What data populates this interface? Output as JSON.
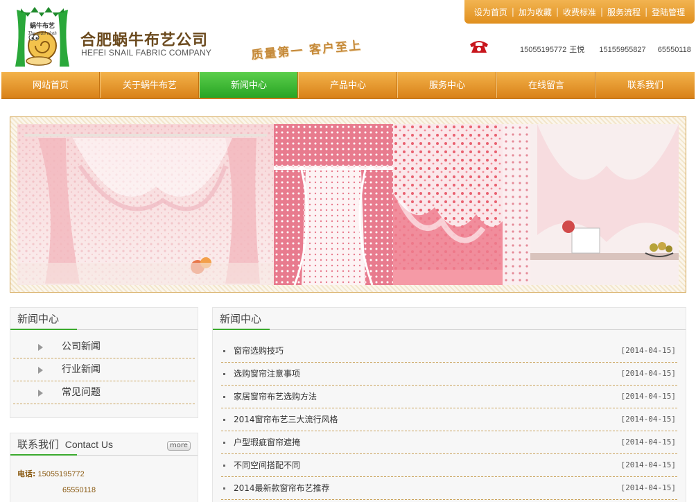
{
  "header": {
    "logo_text_cn": "蜗牛布艺",
    "logo_text_en": "The snail cloth",
    "company_name_cn": "合肥蜗牛布艺公司",
    "company_name_en": "HEFEI SNAIL FABRIC COMPANY",
    "slogan": "质量第一 客户至上",
    "top_links": [
      "设为首页",
      "加为收藏",
      "收费标准",
      "服务流程",
      "登陆管理"
    ],
    "phone_icon": "telephone-icon",
    "phones": [
      "15055195772",
      "王悦",
      "15155955827",
      "65550118"
    ]
  },
  "nav": {
    "items": [
      "网站首页",
      "关于蜗牛布艺",
      "新闻中心",
      "产品中心",
      "服务中心",
      "在线留言",
      "联系我们"
    ],
    "active_index": 2
  },
  "sidebar": {
    "news_title": "新闻中心",
    "categories": [
      "公司新闻",
      "行业新闻",
      "常见问题"
    ],
    "contact_title": "联系我们",
    "contact_title_en": "Contact Us",
    "more": "more",
    "phone_label": "电话:",
    "phone1": "15055195772",
    "phone2": "65550118"
  },
  "main": {
    "title": "新闻中心",
    "news": [
      {
        "title": "窗帘选购技巧",
        "date": "[2014-04-15]"
      },
      {
        "title": "选购窗帘注意事项",
        "date": "[2014-04-15]"
      },
      {
        "title": "家居窗帘布艺选购方法",
        "date": "[2014-04-15]"
      },
      {
        "title": "2014窗帘布艺三大流行风格",
        "date": "[2014-04-15]"
      },
      {
        "title": "户型瑕疵窗帘遮掩",
        "date": "[2014-04-15]"
      },
      {
        "title": "不同空间搭配不同",
        "date": "[2014-04-15]"
      },
      {
        "title": "2014最新款窗帘布艺推荐",
        "date": "[2014-04-15]"
      }
    ]
  },
  "colors": {
    "accent_orange": "#e08f1e",
    "active_green": "#28a424",
    "brand_brown": "#6b4a1e"
  }
}
